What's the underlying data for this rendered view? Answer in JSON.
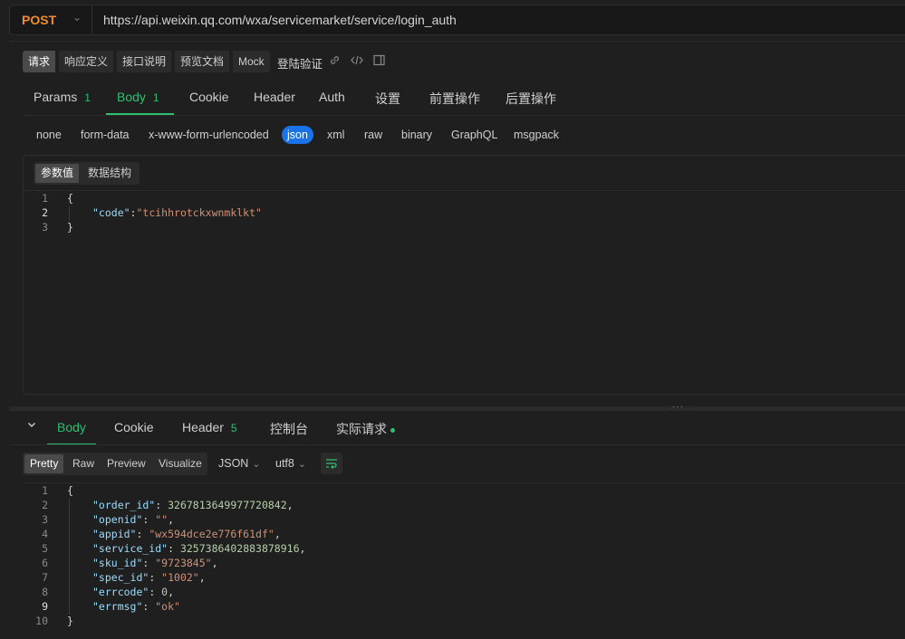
{
  "request": {
    "method": "POST",
    "url": "https://api.weixin.qq.com/wxa/servicemarket/service/login_auth"
  },
  "toolbar": {
    "buttons": [
      "请求",
      "响应定义",
      "接口说明",
      "预览文档",
      "Mock"
    ],
    "label": "登陆验证"
  },
  "tabs": {
    "params": "Params",
    "params_count": "1",
    "body": "Body",
    "body_count": "1",
    "cookie": "Cookie",
    "header": "Header",
    "auth": "Auth",
    "settings": "设置",
    "pre": "前置操作",
    "post": "后置操作"
  },
  "body_types": [
    "none",
    "form-data",
    "x-www-form-urlencoded",
    "json",
    "xml",
    "raw",
    "binary",
    "GraphQL",
    "msgpack"
  ],
  "body_types_active": "json",
  "editor": {
    "seg_values": "参数值",
    "seg_schema": "数据结构",
    "line_numbers": [
      "1",
      "2",
      "3"
    ],
    "open": "{",
    "key": "\"code\"",
    "colon": ":",
    "value": "\"tcihhrotckxwnmklkt\"",
    "close": "}"
  },
  "splitter_dots": "···",
  "response": {
    "tabs": {
      "body": "Body",
      "cookie": "Cookie",
      "header": "Header",
      "header_count": "5",
      "console": "控制台",
      "actual": "实际请求"
    },
    "view_modes": [
      "Pretty",
      "Raw",
      "Preview",
      "Visualize"
    ],
    "format": "JSON",
    "encoding": "utf8",
    "line_numbers": [
      "1",
      "2",
      "3",
      "4",
      "5",
      "6",
      "7",
      "8",
      "9",
      "10"
    ],
    "json": [
      {
        "k": "\"order_id\"",
        "v": "3267813649977720842",
        "t": "num",
        "c": ","
      },
      {
        "k": "\"openid\"",
        "v": "\"\"",
        "t": "str",
        "c": ","
      },
      {
        "k": "\"appid\"",
        "v": "\"wx594dce2e776f61df\"",
        "t": "str",
        "c": ","
      },
      {
        "k": "\"service_id\"",
        "v": "3257386402883878916",
        "t": "num",
        "c": ","
      },
      {
        "k": "\"sku_id\"",
        "v": "\"9723845\"",
        "t": "str",
        "c": ","
      },
      {
        "k": "\"spec_id\"",
        "v": "\"1002\"",
        "t": "str",
        "c": ","
      },
      {
        "k": "\"errcode\"",
        "v": "0",
        "t": "num",
        "c": ","
      },
      {
        "k": "\"errmsg\"",
        "v": "\"ok\"",
        "t": "str",
        "c": ""
      }
    ],
    "open": "{",
    "close": "}"
  },
  "icons": {
    "method_caret": "chevron-down-icon",
    "link": "link-icon",
    "code": "code-icon",
    "layout": "layout-icon",
    "collapse": "chevron-down-icon",
    "wrap": "wrap-lines-icon"
  },
  "colors": {
    "accent_green": "#2fbf71",
    "method_orange": "#f08c2b",
    "active_blue": "#1a73e8"
  }
}
